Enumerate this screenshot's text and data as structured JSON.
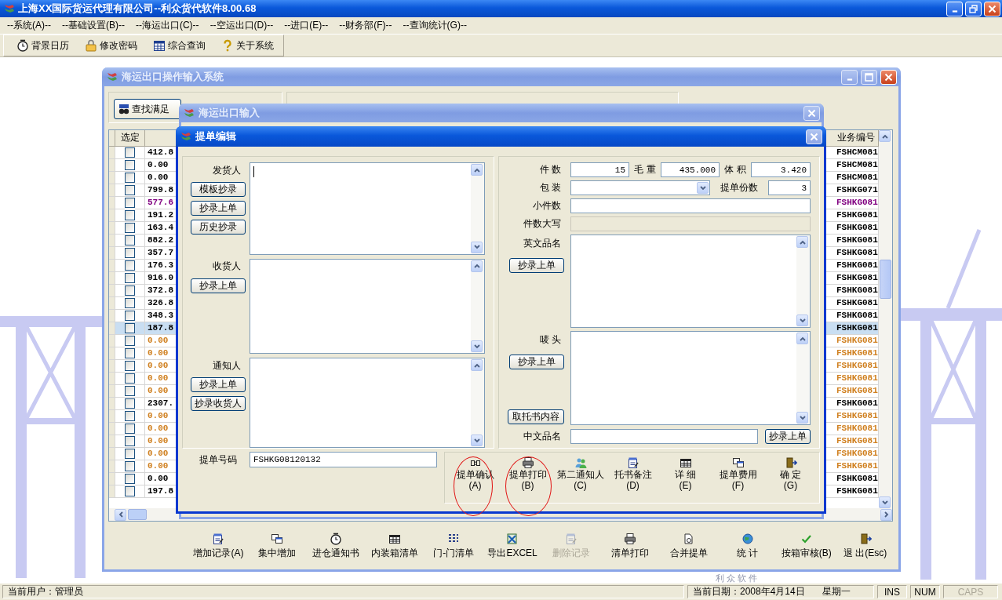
{
  "window": {
    "title": "上海XX国际货运代理有限公司--利众货代软件8.00.68"
  },
  "menu": [
    "--系统(A)--",
    "--基础设置(B)--",
    "--海运出口(C)--",
    "--空运出口(D)--",
    "--进口(E)--",
    "--财务部(F)--",
    "--查询统计(G)--"
  ],
  "toolbar": [
    "背景日历",
    "修改密码",
    "综合查询",
    "关于系统"
  ],
  "background_logo": "利 众 软 件",
  "ops_window": {
    "title": "海运出口操作输入系统",
    "search_button": "查找满足",
    "table": {
      "columns": [
        "选定",
        "业务编号"
      ],
      "rows": [
        {
          "selected": false,
          "checked": false,
          "amount": "412.8",
          "code": "FSHCM081",
          "color": "#000000"
        },
        {
          "selected": false,
          "checked": false,
          "amount": "0.00",
          "code": "FSHCM081",
          "color": "#000000"
        },
        {
          "selected": false,
          "checked": false,
          "amount": "0.00",
          "code": "FSHCM081",
          "color": "#000000"
        },
        {
          "selected": false,
          "checked": false,
          "amount": "799.8",
          "code": "FSHKG071",
          "color": "#000000"
        },
        {
          "selected": false,
          "checked": false,
          "amount": "577.6",
          "code": "FSHKG081",
          "color": "#800080"
        },
        {
          "selected": false,
          "checked": false,
          "amount": "191.2",
          "code": "FSHKG081",
          "color": "#000000"
        },
        {
          "selected": false,
          "checked": false,
          "amount": "163.4",
          "code": "FSHKG081",
          "color": "#000000"
        },
        {
          "selected": false,
          "checked": false,
          "amount": "882.2",
          "code": "FSHKG081",
          "color": "#000000"
        },
        {
          "selected": false,
          "checked": false,
          "amount": "357.7",
          "code": "FSHKG081",
          "color": "#000000"
        },
        {
          "selected": false,
          "checked": false,
          "amount": "176.3",
          "code": "FSHKG081",
          "color": "#000000"
        },
        {
          "selected": false,
          "checked": false,
          "amount": "916.0",
          "code": "FSHKG081",
          "color": "#000000"
        },
        {
          "selected": false,
          "checked": false,
          "amount": "372.8",
          "code": "FSHKG081",
          "color": "#000000"
        },
        {
          "selected": false,
          "checked": false,
          "amount": "326.8",
          "code": "FSHKG081",
          "color": "#000000"
        },
        {
          "selected": false,
          "checked": false,
          "amount": "348.3",
          "code": "FSHKG081",
          "color": "#000000"
        },
        {
          "selected": true,
          "checked": false,
          "amount": "187.8",
          "code": "FSHKG081",
          "color": "#000000"
        },
        {
          "selected": false,
          "checked": false,
          "amount": "0.00",
          "code": "FSHKG081",
          "color": "#d08020"
        },
        {
          "selected": false,
          "checked": false,
          "amount": "0.00",
          "code": "FSHKG081",
          "color": "#d08020"
        },
        {
          "selected": false,
          "checked": false,
          "amount": "0.00",
          "code": "FSHKG081",
          "color": "#d08020"
        },
        {
          "selected": false,
          "checked": false,
          "amount": "0.00",
          "code": "FSHKG081",
          "color": "#d08020"
        },
        {
          "selected": false,
          "checked": false,
          "amount": "0.00",
          "code": "FSHKG081",
          "color": "#d08020"
        },
        {
          "selected": false,
          "checked": false,
          "amount": "2307.",
          "code": "FSHKG081",
          "color": "#000000"
        },
        {
          "selected": false,
          "checked": false,
          "amount": "0.00",
          "code": "FSHKG081",
          "color": "#d08020"
        },
        {
          "selected": false,
          "checked": false,
          "amount": "0.00",
          "code": "FSHKG081",
          "color": "#d08020"
        },
        {
          "selected": false,
          "checked": false,
          "amount": "0.00",
          "code": "FSHKG081",
          "color": "#d08020"
        },
        {
          "selected": false,
          "checked": false,
          "amount": "0.00",
          "code": "FSHKG081",
          "color": "#d08020"
        },
        {
          "selected": false,
          "checked": false,
          "amount": "0.00",
          "code": "FSHKG081",
          "color": "#d08020"
        },
        {
          "selected": false,
          "checked": false,
          "amount": "0.00",
          "code": "FSHKG081",
          "color": "#000000"
        },
        {
          "selected": false,
          "checked": false,
          "amount": "197.8",
          "code": "FSHKG081",
          "color": "#000000"
        }
      ]
    },
    "actions": [
      {
        "label": "增加记录(A)",
        "disabled": false
      },
      {
        "label": "集中增加",
        "disabled": false
      },
      {
        "label": "进仓通知书",
        "disabled": false
      },
      {
        "label": "内装箱清单",
        "disabled": false
      },
      {
        "label": "门-门清单",
        "disabled": false
      },
      {
        "label": "导出EXCEL",
        "disabled": false
      },
      {
        "label": "删除记录",
        "disabled": true
      },
      {
        "label": "清单打印",
        "disabled": false
      },
      {
        "label": "合并提单",
        "disabled": false
      },
      {
        "label": "统 计",
        "disabled": false
      },
      {
        "label": "按箱审核(B)",
        "disabled": false
      },
      {
        "label": "退 出(Esc)",
        "disabled": false
      }
    ]
  },
  "input_window": {
    "title": "海运出口输入"
  },
  "bl_dialog": {
    "title": "提单编辑",
    "parties": [
      {
        "label": "发货人",
        "buttons": [
          "模板抄录",
          "抄录上单",
          "历史抄录"
        ],
        "focused": true
      },
      {
        "label": "收货人",
        "buttons": [
          "抄录上单"
        ],
        "focused": false
      },
      {
        "label": "通知人",
        "buttons": [
          "抄录上单",
          "抄录收货人"
        ],
        "focused": false
      }
    ],
    "measures": [
      {
        "label": "件 数",
        "value": "15"
      },
      {
        "label": "毛 重",
        "value": "435.000"
      },
      {
        "label": "体 积",
        "value": "3.420"
      }
    ],
    "packing": {
      "label": "包 装"
    },
    "copies": {
      "label": "提单份数",
      "value": "3"
    },
    "small_count": {
      "label": "小件数"
    },
    "count_in_words": {
      "label": "件数大写",
      "disabled": true
    },
    "english_name": {
      "label": "英文品名",
      "button": "抄录上单"
    },
    "marks": {
      "label": "唛 头",
      "button": "抄录上单",
      "fetch_button": "取托书内容"
    },
    "chinese_name": {
      "label": "中文品名",
      "button": "抄录上单"
    },
    "bl_number": {
      "label": "提单号码",
      "value": "FSHKG08120132"
    },
    "actions": [
      {
        "label": "提单确认",
        "key": "(A)",
        "circled": true
      },
      {
        "label": "提单打印",
        "key": "(B)",
        "circled": true
      },
      {
        "label": "第二通知人",
        "key": "(C)",
        "circled": false
      },
      {
        "label": "托书备注",
        "key": "(D)",
        "circled": false
      },
      {
        "label": "详 细",
        "key": "(E)",
        "circled": false
      },
      {
        "label": "提单费用",
        "key": "(F)",
        "circled": false
      },
      {
        "label": "确 定",
        "key": "(G)",
        "circled": false
      }
    ]
  },
  "status_bar": {
    "user": "当前用户：管理员",
    "date": "当前日期：2008年4月14日",
    "weekday": "星期一",
    "indicators": [
      {
        "label": "INS",
        "on": true
      },
      {
        "label": "NUM",
        "on": true
      },
      {
        "label": "CAPS",
        "on": false
      }
    ]
  }
}
